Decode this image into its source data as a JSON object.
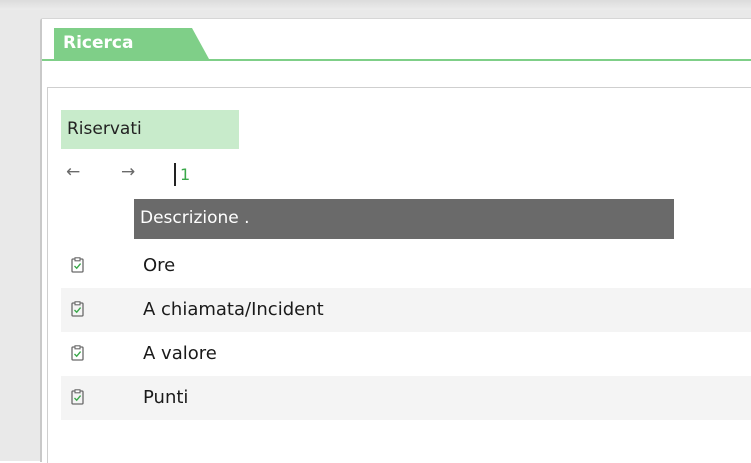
{
  "tab": {
    "label": "Ricerca"
  },
  "section": {
    "label": "Riservati"
  },
  "nav": {
    "back_icon": "←",
    "forward_icon": "→",
    "page": "1"
  },
  "table": {
    "column_header": "Descrizione .",
    "rows": [
      {
        "label": "Ore",
        "icon": "clipboard-check-icon"
      },
      {
        "label": "A chiamata/Incident",
        "icon": "clipboard-check-icon"
      },
      {
        "label": "A valore",
        "icon": "clipboard-check-icon"
      },
      {
        "label": "Punti",
        "icon": "clipboard-check-icon"
      }
    ]
  },
  "colors": {
    "accent_green": "#7fcf88",
    "section_bg": "#c8ebcb",
    "header_gray": "#6a6a6a",
    "page_number": "#3aa84a"
  }
}
